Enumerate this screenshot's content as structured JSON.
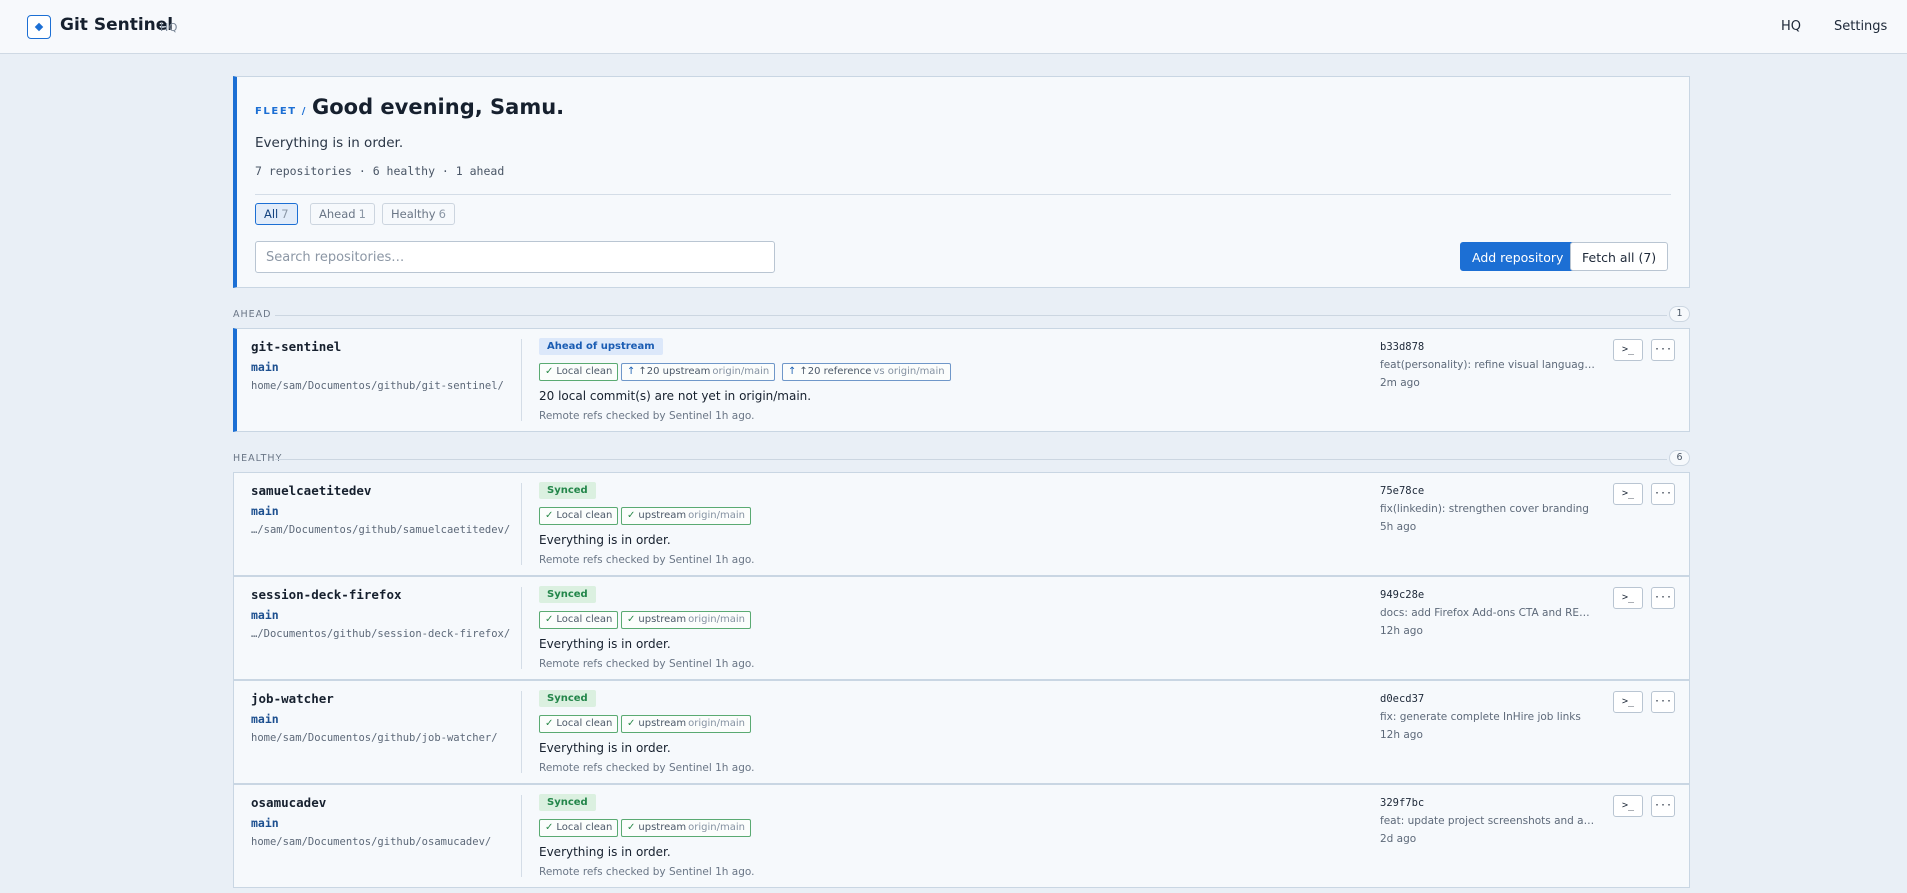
{
  "app": {
    "title": "Git Sentinel",
    "subtitle": "HQ"
  },
  "nav": {
    "hq": "HQ",
    "settings": "Settings"
  },
  "hero": {
    "crumb": "FLEET /",
    "greeting": "Good evening, Samu.",
    "status": "Everything is in order.",
    "stats": "7 repositories · 6 healthy · 1 ahead",
    "filters": [
      {
        "label": "All",
        "count": "7",
        "active": true
      },
      {
        "label": "Ahead",
        "count": "1",
        "active": false
      },
      {
        "label": "Healthy",
        "count": "6",
        "active": false
      }
    ],
    "search_placeholder": "Search repositories…",
    "add_button": "Add repository",
    "fetch_button": "Fetch all (7)"
  },
  "sections": {
    "ahead": {
      "label": "AHEAD",
      "count": "1"
    },
    "healthy": {
      "label": "HEALTHY",
      "count": "6"
    }
  },
  "icons": {
    "check": "check-icon",
    "arrow_up": "arrow-up-icon",
    "terminal": "terminal-icon",
    "more": "more-icon",
    "logo": "diamond-logo-icon"
  },
  "colors": {
    "accent": "#1c6fd4",
    "synced": "#23864a",
    "ahead_badge_bg": "#dce8fa",
    "synced_badge_bg": "#dbf0e0"
  },
  "repos": [
    {
      "name": "git-sentinel",
      "branch": "main",
      "path": "home/sam/Documentos/github/git-sentinel/",
      "badge": "Ahead of upstream",
      "local": "Local clean",
      "upstream_main": "↑20 upstream",
      "upstream_sub": "origin/main",
      "ref_main": "↑20 reference",
      "ref_sub": "vs origin/main",
      "message": "20 local commit(s) are not yet in origin/main.",
      "check": "Remote refs checked by Sentinel 1h ago.",
      "sha": "b33d878",
      "commit": "feat(personality): refine visual languages",
      "ago": "2m ago"
    },
    {
      "name": "samuelcaetitedev",
      "branch": "main",
      "path": "…/sam/Documentos/github/samuelcaetitedev/",
      "badge": "Synced",
      "local": "Local clean",
      "upstream_main": "upstream",
      "upstream_sub": "origin/main",
      "message": "Everything is in order.",
      "check": "Remote refs checked by Sentinel 1h ago.",
      "sha": "75e78ce",
      "commit": "fix(linkedin): strengthen cover branding",
      "ago": "5h ago"
    },
    {
      "name": "session-deck-firefox",
      "branch": "main",
      "path": "…/Documentos/github/session-deck-firefox/",
      "badge": "Synced",
      "local": "Local clean",
      "upstream_main": "upstream",
      "upstream_sub": "origin/main",
      "message": "Everything is in order.",
      "check": "Remote refs checked by Sentinel 1h ago.",
      "sha": "949c28e",
      "commit": "docs: add Firefox Add-ons CTA and READ…",
      "ago": "12h ago"
    },
    {
      "name": "job-watcher",
      "branch": "main",
      "path": "home/sam/Documentos/github/job-watcher/",
      "badge": "Synced",
      "local": "Local clean",
      "upstream_main": "upstream",
      "upstream_sub": "origin/main",
      "message": "Everything is in order.",
      "check": "Remote refs checked by Sentinel 1h ago.",
      "sha": "d0ecd37",
      "commit": "fix: generate complete InHire job links",
      "ago": "12h ago"
    },
    {
      "name": "osamucadev",
      "branch": "main",
      "path": "home/sam/Documentos/github/osamucadev/",
      "badge": "Synced",
      "local": "Local clean",
      "upstream_main": "upstream",
      "upstream_sub": "origin/main",
      "message": "Everything is in order.",
      "check": "Remote refs checked by Sentinel 1h ago.",
      "sha": "329f7bc",
      "commit": "feat: update project screenshots and add …",
      "ago": "2d ago"
    }
  ]
}
